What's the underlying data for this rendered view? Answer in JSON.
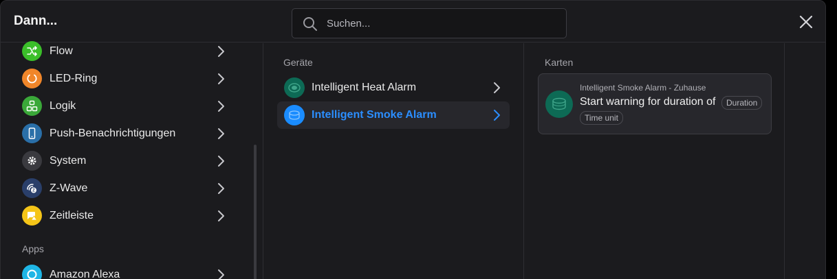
{
  "header": {
    "title": "Dann...",
    "search_placeholder": "Suchen...",
    "search_value": ""
  },
  "categories": [
    {
      "label": "Flow",
      "icon": "shuffle-icon",
      "color": "#2bb673"
    },
    {
      "label": "LED-Ring",
      "icon": "ring-icon",
      "color": "#f0862a"
    },
    {
      "label": "Logik",
      "icon": "logic-icon",
      "color": "#3aa839"
    },
    {
      "label": "Push-Benachrichtigungen",
      "icon": "phone-icon",
      "color": "#2a6fa8"
    },
    {
      "label": "System",
      "icon": "gear-icon",
      "color": "#3a3a3f"
    },
    {
      "label": "Z-Wave",
      "icon": "zwave-icon",
      "color": "#2a3f6a"
    },
    {
      "label": "Zeitleiste",
      "icon": "timeline-icon",
      "color": "#f5c518"
    }
  ],
  "apps_section": {
    "label": "Apps",
    "items": [
      {
        "label": "Amazon Alexa",
        "icon": "alexa-icon",
        "color": "#1fb6e6"
      }
    ]
  },
  "devices": {
    "section_label": "Geräte",
    "items": [
      {
        "label": "Intelligent Heat Alarm",
        "selected": false,
        "icon": "heat-alarm-icon",
        "color": "#0d6a55"
      },
      {
        "label": "Intelligent Smoke Alarm",
        "selected": true,
        "icon": "smoke-alarm-icon",
        "color": "#1a8cff"
      }
    ]
  },
  "cards": {
    "section_label": "Karten",
    "items": [
      {
        "subtitle": "Intelligent Smoke Alarm - Zuhause",
        "text": "Start warning for duration of",
        "tags": [
          "Duration",
          "Time unit"
        ]
      }
    ]
  },
  "colors": {
    "accent": "#2b8eff",
    "background": "#1b1b1e"
  }
}
